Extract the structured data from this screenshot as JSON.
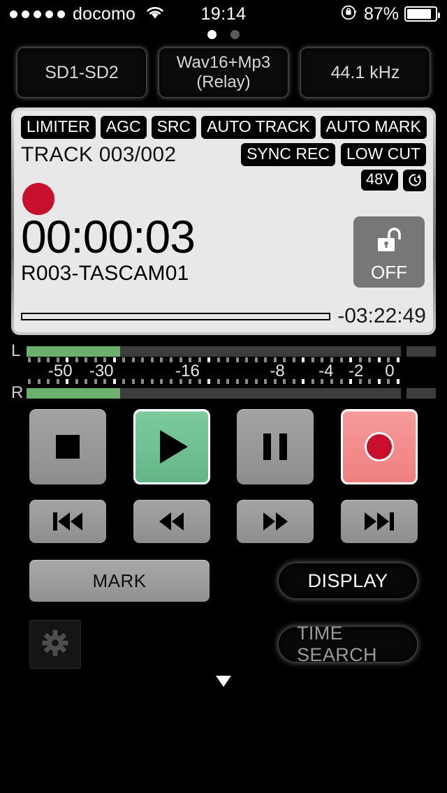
{
  "status_bar": {
    "carrier": "docomo",
    "signal_dots": 5,
    "wifi_icon": "wifi-icon",
    "time": "19:14",
    "rotation_lock_icon": "rotation-lock-icon",
    "battery_percent": "87%",
    "battery_level": 87
  },
  "page_indicator": {
    "total": 2,
    "active": 1
  },
  "top_selectors": [
    {
      "name": "card-selector",
      "label": "SD1-SD2"
    },
    {
      "name": "format-selector",
      "label": "Wav16+Mp3",
      "label2": "(Relay)"
    },
    {
      "name": "samplerate-selector",
      "label": "44.1 kHz"
    }
  ],
  "lcd": {
    "badges": [
      "LIMITER",
      "AGC",
      "SRC",
      "AUTO TRACK",
      "AUTO MARK"
    ],
    "track_label": "TRACK 003/002",
    "right_badges": [
      "SYNC REC",
      "LOW CUT"
    ],
    "phantom_badge": "48V",
    "timer_icon": "timer-icon",
    "rec_indicator": "record-status-indicator",
    "elapsed_time": "00:00:03",
    "file_name": "R003-TASCAM01",
    "lock": {
      "icon": "unlock-icon",
      "label": "OFF"
    },
    "progress_percent": 0,
    "remaining_time": "-03:22:49"
  },
  "meters": {
    "left_label": "L",
    "right_label": "R",
    "left_level_percent": 25,
    "right_level_percent": 25,
    "scale_labels": [
      {
        "text": "-50",
        "pos": 9
      },
      {
        "text": "-30",
        "pos": 20
      },
      {
        "text": "-16",
        "pos": 43
      },
      {
        "text": "-8",
        "pos": 67
      },
      {
        "text": "-4",
        "pos": 80
      },
      {
        "text": "-2",
        "pos": 88
      },
      {
        "text": "0",
        "pos": 97
      }
    ],
    "meter_color": "#6cb06e"
  },
  "transport": [
    {
      "name": "stop-button",
      "icon": "stop-icon",
      "label": "Stop",
      "state": "normal"
    },
    {
      "name": "play-button",
      "icon": "play-icon",
      "label": "Play",
      "state": "active"
    },
    {
      "name": "pause-button",
      "icon": "pause-icon",
      "label": "Pause",
      "state": "normal"
    },
    {
      "name": "record-button",
      "icon": "record-icon",
      "label": "Record",
      "state": "active"
    }
  ],
  "skip_buttons": [
    {
      "name": "previous-track-button",
      "icon": "skip-previous-icon"
    },
    {
      "name": "rewind-button",
      "icon": "rewind-icon"
    },
    {
      "name": "fast-forward-button",
      "icon": "fast-forward-icon"
    },
    {
      "name": "next-track-button",
      "icon": "skip-next-icon"
    }
  ],
  "actions": {
    "mark_label": "MARK",
    "display_label": "DISPLAY",
    "time_search_label": "TIME SEARCH",
    "settings_icon": "gear-icon",
    "scroll_hint_icon": "chevron-down-icon"
  },
  "colors": {
    "accent_green": "#6fc092",
    "accent_red": "#c8102e",
    "record_button": "#f38b8b",
    "lcd_background": "#e8e8e8",
    "button_gray": "#999999"
  }
}
